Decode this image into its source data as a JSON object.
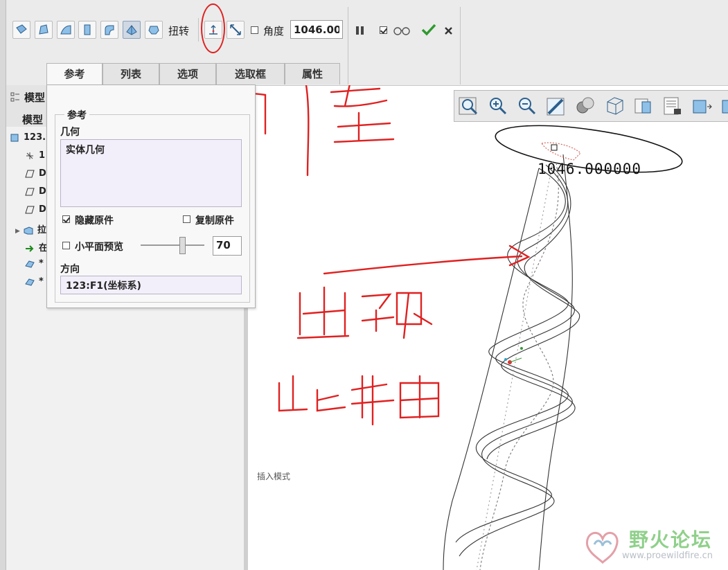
{
  "ribbon": {
    "twist_label": "扭转",
    "angle_label": "角度",
    "angle_value": "1046.00",
    "angle_checked": false,
    "preview_checked": true
  },
  "tabs": [
    {
      "label": "参考",
      "active": true
    },
    {
      "label": "列表",
      "active": false
    },
    {
      "label": "选项",
      "active": false
    },
    {
      "label": "选取框",
      "active": false
    },
    {
      "label": "属性",
      "active": false
    }
  ],
  "model_tree": {
    "header": "模型",
    "subheader": "模型",
    "rows": [
      {
        "label": "123.",
        "icon": "part-icon"
      },
      {
        "label": "1",
        "icon": "csys-icon"
      },
      {
        "label": "D",
        "icon": "datum-plane-icon"
      },
      {
        "label": "D",
        "icon": "datum-plane-icon"
      },
      {
        "label": "D",
        "icon": "datum-plane-icon"
      },
      {
        "label": "拉",
        "icon": "extrude-icon"
      },
      {
        "label": "在",
        "icon": "insert-here-arrow-icon"
      },
      {
        "label": "*",
        "icon": "twist-feature-icon"
      },
      {
        "label": "*",
        "icon": "twist-feature-icon"
      }
    ]
  },
  "panel": {
    "group_title": "参考",
    "geometry_label": "几何",
    "geometry_value": "实体几何",
    "hide_original_label": "隐藏原件",
    "hide_original_checked": true,
    "copy_original_label": "复制原件",
    "copy_original_checked": false,
    "facet_preview_label": "小平面预览",
    "facet_preview_checked": false,
    "slider_value": "70",
    "slider_fraction": 0.65,
    "direction_label": "方向",
    "direction_value": "123:F1(坐标系)"
  },
  "graphics": {
    "dimension_text": "1046.000000",
    "status_text": "插入模式",
    "annotation_color": "#e02020"
  },
  "watermark": {
    "title": "野火论坛",
    "url": "www.proewildfire.cn"
  },
  "colors": {
    "ribbon_bg": "#ebebeb",
    "panel_input_bg": "#f3effa",
    "accept_green": "#2f9a2f"
  }
}
